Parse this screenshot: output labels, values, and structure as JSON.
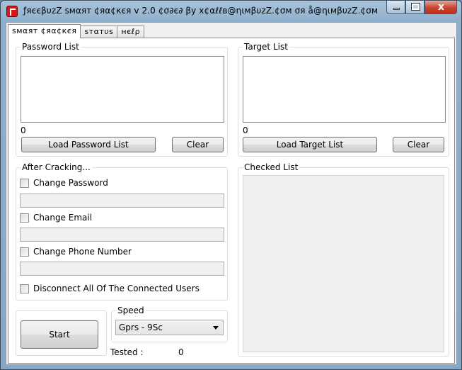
{
  "window": {
    "title": "ƒяєєβυzZ ѕмαят ¢яα¢кєя v 2.0 ¢σ∂є∂ βу x¢αℓℓв@ηιмβυzZ.¢σм σя å@ηιмβυzZ.¢σм",
    "minimize_icon": "minimize-icon",
    "maximize_icon": "maximize-icon",
    "close_label": "x",
    "close_icon": "close-icon"
  },
  "tabs": [
    {
      "label": "ѕмαят ¢яα¢кєя",
      "active": true
    },
    {
      "label": "ѕтαтυѕ",
      "active": false
    },
    {
      "label": "нєℓρ",
      "active": false
    }
  ],
  "password_list": {
    "title": "Password List",
    "count": "0",
    "load_label": "Load Password List",
    "clear_label": "Clear"
  },
  "target_list": {
    "title": "Target List",
    "count": "0",
    "load_label": "Load Target List",
    "clear_label": "Clear"
  },
  "after_cracking": {
    "title": "After Cracking...",
    "change_password": {
      "label": "Change Password",
      "checked": false,
      "value": ""
    },
    "change_email": {
      "label": "Change Email",
      "checked": false,
      "value": ""
    },
    "change_phone": {
      "label": "Change Phone Number",
      "checked": false,
      "value": ""
    },
    "disconnect": {
      "label": "Disconnect All Of The Connected Users",
      "checked": false
    }
  },
  "checked_list": {
    "title": "Checked List"
  },
  "controls": {
    "start_label": "Start",
    "speed_title": "Speed",
    "speed_value": "Gprs - 9Sc",
    "tested_label": "Tested :",
    "tested_value": "0"
  },
  "colors": {
    "title_bar": "#8fb0cd",
    "close_button": "#c7442e",
    "panel_bg": "#ffffff",
    "disabled_field": "#f0f0f0"
  }
}
